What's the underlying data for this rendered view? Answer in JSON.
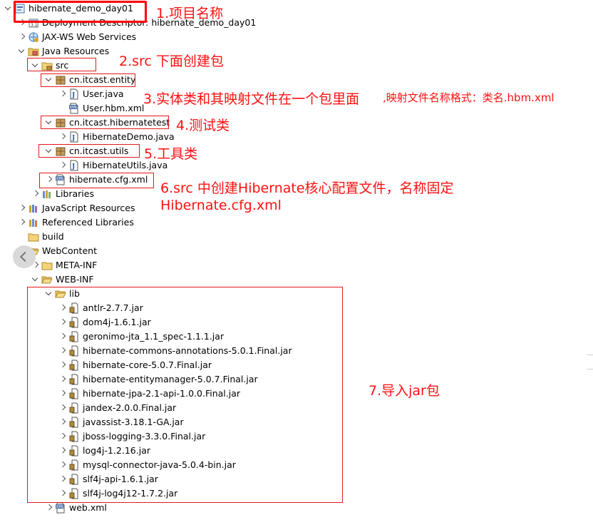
{
  "tree": [
    {
      "label": "hibernate_demo_day01",
      "arrow": "d",
      "icon": "project-icon"
    },
    {
      "label": "Deployment Descriptor: hibernate_demo_day01",
      "arrow": "r",
      "icon": "deployment-descriptor-icon"
    },
    {
      "label": "JAX-WS Web Services",
      "arrow": "r",
      "icon": "web-services-icon"
    },
    {
      "label": "Java Resources",
      "arrow": "d",
      "icon": "java-resources-icon"
    },
    {
      "label": "src",
      "arrow": "d",
      "icon": "source-folder-icon"
    },
    {
      "label": "cn.itcast.entity",
      "arrow": "d",
      "icon": "package-icon"
    },
    {
      "label": "User.java",
      "arrow": "r",
      "icon": "java-file-icon"
    },
    {
      "label": "User.hbm.xml",
      "arrow": "",
      "icon": "xml-file-icon"
    },
    {
      "label": "cn.itcast.hibernatetest",
      "arrow": "d",
      "icon": "package-icon"
    },
    {
      "label": "HibernateDemo.java",
      "arrow": "r",
      "icon": "java-file-icon"
    },
    {
      "label": "cn.itcast.utils",
      "arrow": "d",
      "icon": "package-icon"
    },
    {
      "label": "HibernateUtils.java",
      "arrow": "r",
      "icon": "java-file-icon"
    },
    {
      "label": "hibernate.cfg.xml",
      "arrow": "r",
      "icon": "xml-file-icon"
    },
    {
      "label": "Libraries",
      "arrow": "r",
      "icon": "libraries-icon"
    },
    {
      "label": "JavaScript Resources",
      "arrow": "r",
      "icon": "javascript-resources-icon"
    },
    {
      "label": "Referenced Libraries",
      "arrow": "r",
      "icon": "referenced-libraries-icon"
    },
    {
      "label": "build",
      "arrow": "",
      "icon": "folder-icon"
    },
    {
      "label": "WebContent",
      "arrow": "d",
      "icon": "folder-open-icon"
    },
    {
      "label": "META-INF",
      "arrow": "r",
      "icon": "folder-icon"
    },
    {
      "label": "WEB-INF",
      "arrow": "d",
      "icon": "folder-open-icon"
    },
    {
      "label": "lib",
      "arrow": "d",
      "icon": "folder-open-icon"
    },
    {
      "label": "antlr-2.7.7.jar",
      "arrow": "r",
      "icon": "jar-icon"
    },
    {
      "label": "dom4j-1.6.1.jar",
      "arrow": "r",
      "icon": "jar-icon"
    },
    {
      "label": "geronimo-jta_1.1_spec-1.1.1.jar",
      "arrow": "r",
      "icon": "jar-icon"
    },
    {
      "label": "hibernate-commons-annotations-5.0.1.Final.jar",
      "arrow": "r",
      "icon": "jar-icon"
    },
    {
      "label": "hibernate-core-5.0.7.Final.jar",
      "arrow": "r",
      "icon": "jar-icon"
    },
    {
      "label": "hibernate-entitymanager-5.0.7.Final.jar",
      "arrow": "r",
      "icon": "jar-icon"
    },
    {
      "label": "hibernate-jpa-2.1-api-1.0.0.Final.jar",
      "arrow": "r",
      "icon": "jar-icon"
    },
    {
      "label": "jandex-2.0.0.Final.jar",
      "arrow": "r",
      "icon": "jar-icon"
    },
    {
      "label": "javassist-3.18.1-GA.jar",
      "arrow": "r",
      "icon": "jar-icon"
    },
    {
      "label": "jboss-logging-3.3.0.Final.jar",
      "arrow": "r",
      "icon": "jar-icon"
    },
    {
      "label": "log4j-1.2.16.jar",
      "arrow": "r",
      "icon": "jar-icon"
    },
    {
      "label": "mysql-connector-java-5.0.4-bin.jar",
      "arrow": "r",
      "icon": "jar-icon"
    },
    {
      "label": "slf4j-api-1.6.1.jar",
      "arrow": "r",
      "icon": "jar-icon"
    },
    {
      "label": "slf4j-log4j12-1.7.2.jar",
      "arrow": "r",
      "icon": "jar-icon"
    },
    {
      "label": "web.xml",
      "arrow": "r",
      "icon": "xml-file-icon"
    }
  ],
  "annotations": {
    "project_name": "1.项目名称",
    "create_package": "2.src 下面创建包",
    "entity_main": "3.实体类和其映射文件在一个包里面",
    "entity_sub": ",映射文件名称格式：类名.hbm.xml",
    "test_class": "4.测试类",
    "utils_class": "5.工具类",
    "config_line1": "6.src 中创建Hibernate核心配置文件，名称固定",
    "config_line2": "Hibernate.cfg.xml",
    "import_jars": "7.导入jar包"
  },
  "colors": {
    "annotation": "#ff1111",
    "highlight_box": "#e31a1a"
  }
}
